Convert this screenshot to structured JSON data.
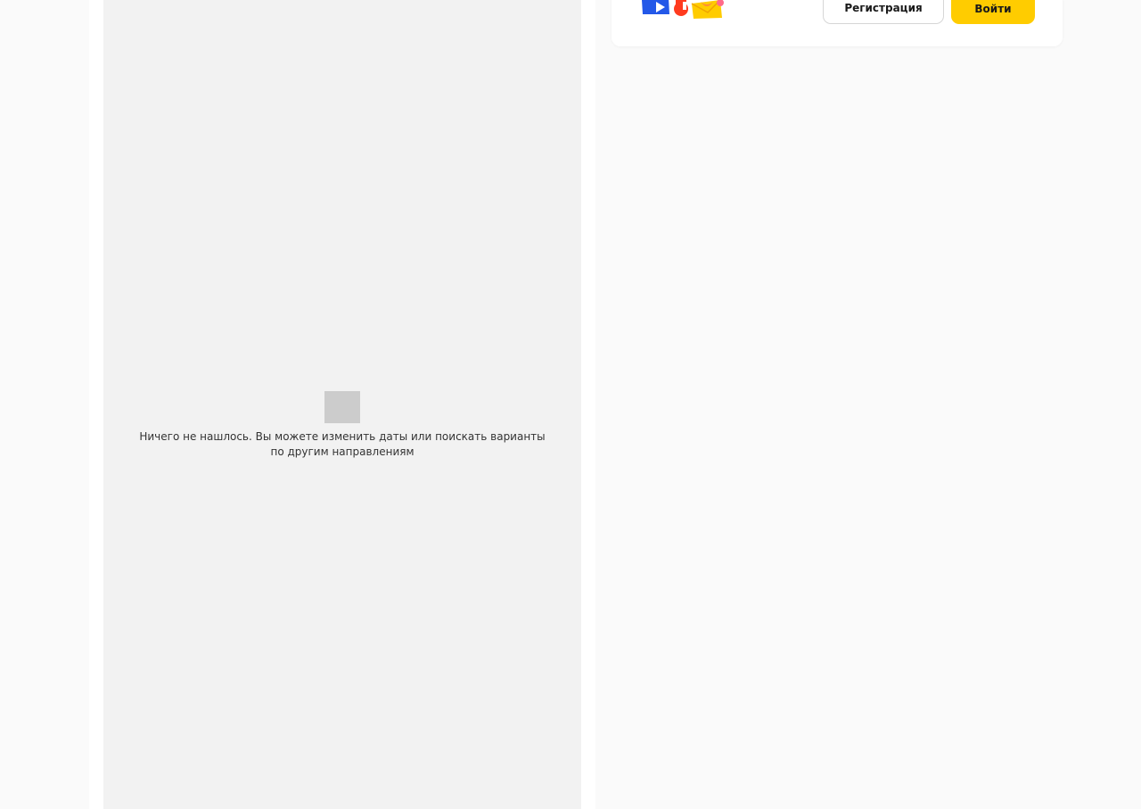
{
  "results": {
    "empty_message": "Ничего не нашлось. Вы можете изменить даты или поискать варианты по другим направлениям"
  },
  "auth": {
    "register_label": "Регистрация",
    "login_label": "Войти"
  },
  "colors": {
    "accent": "#ffcc00",
    "background": "#fafafa",
    "panel": "#f2f2f2"
  }
}
